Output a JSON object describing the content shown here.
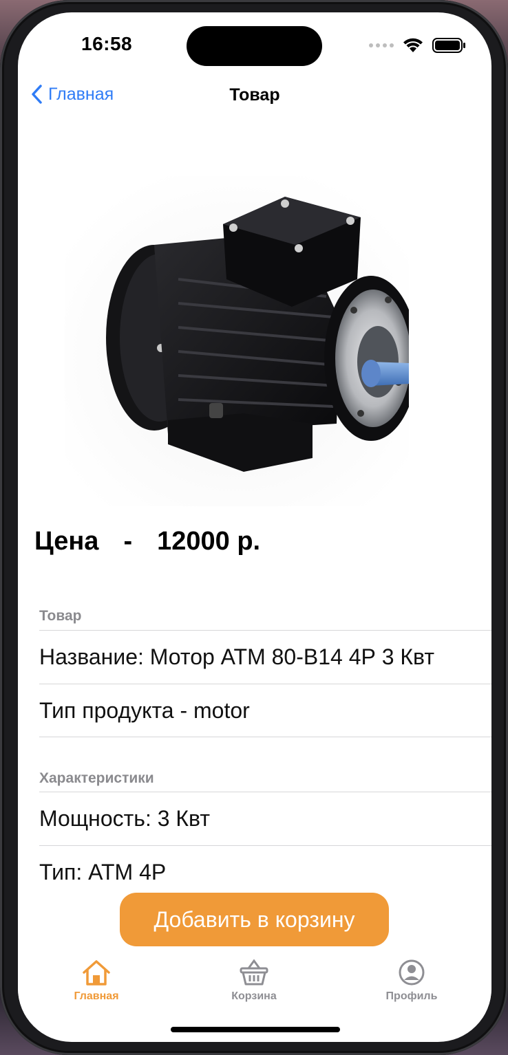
{
  "status": {
    "time": "16:58"
  },
  "nav": {
    "back_label": "Главная",
    "title": "Товар"
  },
  "product": {
    "price_label": "Цена",
    "price_separator": "-",
    "price_value": "12000 р."
  },
  "sections": [
    {
      "header": "Товар",
      "rows": [
        "Название: Мотор АТМ 80-В14 4Р 3 Квт",
        "Тип продукта - motor"
      ]
    },
    {
      "header": "Характеристики",
      "rows": [
        "Мощность: 3 Квт",
        "Тип: АТМ 4Р"
      ]
    }
  ],
  "cart_button": {
    "label": "Добавить в корзину"
  },
  "tabbar": {
    "items": [
      {
        "label": "Главная",
        "icon": "house-icon",
        "active": true
      },
      {
        "label": "Корзина",
        "icon": "basket-icon",
        "active": false
      },
      {
        "label": "Профиль",
        "icon": "person-circle-icon",
        "active": false
      }
    ]
  },
  "colors": {
    "accent": "#f09a38",
    "link": "#2f7cf6",
    "inactive": "#8e8e93"
  }
}
